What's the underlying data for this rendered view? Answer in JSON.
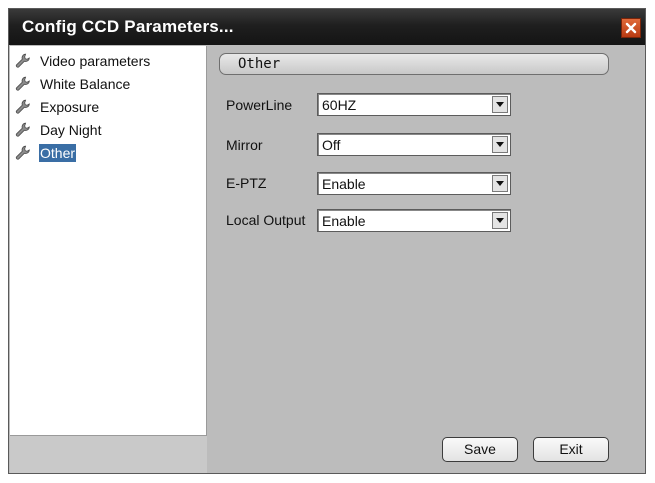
{
  "window": {
    "title": "Config CCD Parameters...",
    "close_icon": "close-icon",
    "accent_color": "#d34b1a"
  },
  "sidebar": {
    "items": [
      {
        "label": "Video parameters",
        "icon": "wrench-icon",
        "selected": false
      },
      {
        "label": "White Balance",
        "icon": "wrench-icon",
        "selected": false
      },
      {
        "label": "Exposure",
        "icon": "wrench-icon",
        "selected": false
      },
      {
        "label": "Day Night",
        "icon": "wrench-icon",
        "selected": false
      },
      {
        "label": "Other",
        "icon": "wrench-icon",
        "selected": true
      }
    ],
    "selection_color": "#3a6ea5"
  },
  "main": {
    "section_title": "Other",
    "fields": [
      {
        "label": "PowerLine",
        "value": "60HZ"
      },
      {
        "label": "Mirror",
        "value": "Off"
      },
      {
        "label": "E-PTZ",
        "value": "Enable"
      },
      {
        "label": "Local Output",
        "value": "Enable"
      }
    ]
  },
  "buttons": {
    "save_label": "Save",
    "exit_label": "Exit"
  }
}
